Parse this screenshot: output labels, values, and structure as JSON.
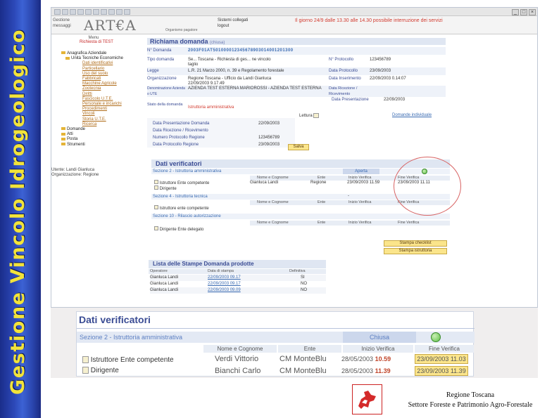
{
  "side_title": "Gestione Vincolo Idrogeologico",
  "header": {
    "left_links": [
      "Gestione",
      "messaggi"
    ],
    "logo": "ART€A",
    "logo_sub": "Organismo pagatore",
    "user_links": [
      "Sistemi collegati",
      "logout"
    ],
    "notice": "Il giorno 24/9 dalle 13.30 alle 14.30 possibile interruzione dei servizi"
  },
  "leftnav": {
    "menu": "Menu",
    "menu_sub": "Richiesta di TEST",
    "items": [
      {
        "label": "Anagrafica Aziendale",
        "level": 1
      },
      {
        "label": "Unità Tecniche Economiche",
        "level": 2
      },
      {
        "label": "Dati identificativi",
        "level": 3
      },
      {
        "label": "Particellario",
        "level": 3
      },
      {
        "label": "Uso del suolo",
        "level": 3
      },
      {
        "label": "Fabbricati",
        "level": 3
      },
      {
        "label": "Macchine Agricole",
        "level": 3
      },
      {
        "label": "Zootecnia",
        "level": 3
      },
      {
        "label": "Diritti",
        "level": 3
      },
      {
        "label": "Fascicolo U.T.E.",
        "level": 3
      },
      {
        "label": "Personale e incarichi",
        "level": 3
      },
      {
        "label": "Procedimenti",
        "level": 3
      },
      {
        "label": "Vincoli",
        "level": 3
      },
      {
        "label": "Storia U.T.E.",
        "level": 3
      },
      {
        "label": "Ricerca",
        "level": 3
      },
      {
        "label": "Domande",
        "level": 1
      },
      {
        "label": "Atti",
        "level": 1
      },
      {
        "label": "Posta",
        "level": 1
      },
      {
        "label": "Strumenti",
        "level": 1
      }
    ],
    "user": "Utente: Landi Gianluca",
    "org": "Organizzazione: Regione"
  },
  "richiama": {
    "title": "Richiama domanda",
    "status": "(chiusa)",
    "rows": [
      {
        "label": "N° Domanda",
        "value": "2 0 0 3 F 0 1 A T 5 0 1 0 0 0 0 1 2 3 4 5 6 7 8 9 0 3 0 1 4 0 0 1 2 0 1 3 0 0",
        "rlabel": "",
        "rvalue": ""
      },
      {
        "label": "Tipo domanda",
        "value": "Se... Toscana - Richiesta di ges... ne vincolo",
        "rlabel": "N° Protocollo",
        "rvalue": "123456789"
      },
      {
        "label": "",
        "value": "taglio",
        "rlabel": "",
        "rvalue": ""
      },
      {
        "label": "Legge",
        "value": "L.R. 21 Marzo 2000, n. 39 e Regolamento forestale",
        "rlabel": "Data Protocollo",
        "rvalue": "23/09/2003"
      },
      {
        "label": "Organizzazione",
        "value": "Regione Toscana - Ufficio da Landi Gianluca",
        "rlabel": "Data Inserimento",
        "rvalue": "22/09/2003 0.14:07"
      },
      {
        "label": "",
        "value": "22/09/2003 9.17.49",
        "rlabel": "",
        "rvalue": ""
      },
      {
        "label": "Denominazione Azienda o UTE",
        "value": "AZIENDA TEST ESTERNA MARIOROSSI - AZIENDA TEST ESTERNA",
        "rlabel": "Data Ricezione / Ricevimento",
        "rvalue": ""
      },
      {
        "label": "",
        "value": "",
        "rlabel": "Data Presentazione",
        "rvalue": "22/09/2003"
      },
      {
        "label": "Stato della domanda",
        "value": "Istruttoria amministrativa",
        "rlabel": "",
        "rvalue": ""
      }
    ],
    "lettura": "Lettura",
    "link": "Domande individuale"
  },
  "protocollo": [
    {
      "label": "Data Presentazione Domanda",
      "value": "22/09/2003"
    },
    {
      "label": "Data Ricezione / Ricevimento",
      "value": ""
    },
    {
      "label": "Numero Protocollo Regione",
      "value": "123456789"
    },
    {
      "label": "Data Protocollo Regione",
      "value": "23/09/2003"
    }
  ],
  "salva": "Salva",
  "verificatori": {
    "title": "Dati verificatori",
    "sec2": "Sezione 2 - Istruttoria amministrativa",
    "sec2_status": "Aperta",
    "headers": [
      "Nome e Cognome",
      "Ente",
      "Inizio Verifica",
      "Fine Verifica"
    ],
    "sec2_rows": [
      {
        "role": "Istruttore Ente competente",
        "name": "Gianluca Landi",
        "ente": "Regione",
        "inizio": "23/09/2003 11.59",
        "fine": "23/09/2003 11.11"
      },
      {
        "role": "Dirigente",
        "name": "",
        "ente": "",
        "inizio": "",
        "fine": ""
      }
    ],
    "sec4": "Sezione 4 - Istruttoria tecnica",
    "sec4_row": "Istruttore ente competente",
    "sec4_dash": "-",
    "sec10": "Sezione 10 - Rilascio autorizzazione",
    "sec10_row": "Dirigente Ente delegato"
  },
  "buttons": [
    "Stampa checklist",
    "Stampa istruttoria"
  ],
  "stampe": {
    "title": "Lista delle Stampe Domanda prodotte",
    "headers": [
      "Operatore",
      "Data di stampa",
      "Definitiva"
    ],
    "rows": [
      {
        "op": "Gianluca Landi",
        "date": "22/09/2003 09.17",
        "def": "SI"
      },
      {
        "op": "Gianluca Landi",
        "date": "22/09/2003 09.17",
        "def": "NO"
      },
      {
        "op": "Gianluca Landi",
        "date": "22/09/2003 09.09",
        "def": "NO"
      }
    ]
  },
  "zoom": {
    "title": "Dati verificatori",
    "sec2": "Sezione 2 - Istruttoria amministrativa",
    "status": "Chiusa",
    "headers": [
      "Nome e Cognome",
      "Ente",
      "Inizio Verifica",
      "Fine Verifica"
    ],
    "rows": [
      {
        "role": "Istruttore Ente competente",
        "name": "Verdi Vittorio",
        "ente": "CM MonteBlu",
        "inizio_date": "28/05/2003",
        "inizio_time": "10.59",
        "fine": "23/09/2003 11.03"
      },
      {
        "role": "Dirigente",
        "name": "Bianchi Carlo",
        "ente": "CM MonteBlu",
        "inizio_date": "28/05/2003",
        "inizio_time": "11.39",
        "fine": "23/09/2003 11.39"
      }
    ]
  },
  "footer": {
    "line1": "Regione Toscana",
    "line2": "Settore Foreste e Patrimonio Agro-Forestale"
  }
}
